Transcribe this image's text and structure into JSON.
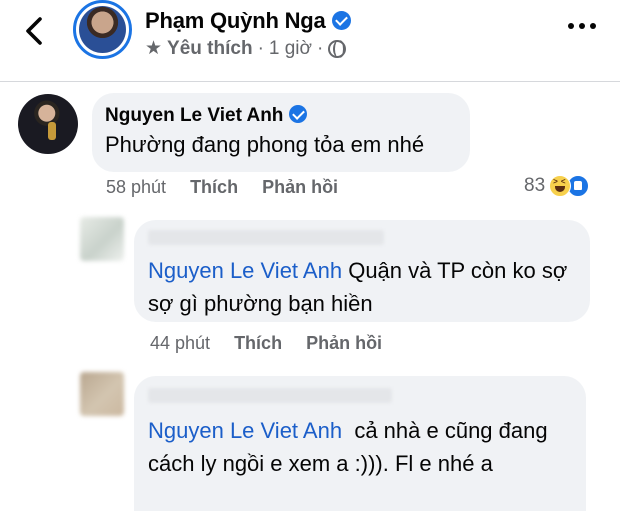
{
  "header": {
    "page_name": "Phạm Quỳnh Nga",
    "meta_label": "Yêu thích",
    "meta_separator": "·",
    "meta_time": "1 giờ",
    "meta_separator2": "·"
  },
  "comments": [
    {
      "author": "Nguyen Le Viet Anh",
      "verified": true,
      "text": "Phường đang phong tỏa em nhé",
      "time": "58 phút",
      "like_label": "Thích",
      "reply_label": "Phản hồi",
      "reaction_count": "83"
    }
  ],
  "replies": [
    {
      "mention": "Nguyen Le Viet Anh",
      "text": " Quận và TP còn ko sợ sợ gì phường bạn hiền",
      "time": "44 phút",
      "like_label": "Thích",
      "reply_label": "Phản hồi"
    },
    {
      "mention": "Nguyen Le Viet Anh",
      "text": "  cả nhà e cũng đang cách ly ngồi e xem a :))). Fl e nhé a"
    }
  ],
  "colors": {
    "accent": "#1b74e4",
    "mention": "#1b5ec9",
    "bubble": "#f0f2f5",
    "secondary_text": "#65676b"
  },
  "icons": [
    "back-arrow-icon",
    "verified-badge-icon",
    "star-icon",
    "globe-icon",
    "more-options-icon",
    "haha-reaction-icon",
    "like-reaction-icon"
  ]
}
